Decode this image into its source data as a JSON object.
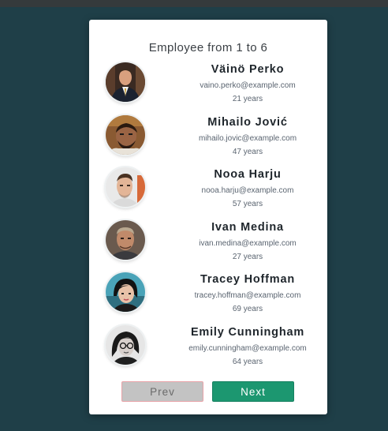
{
  "header": {
    "title": "Employee from 1 to 6"
  },
  "employees": [
    {
      "name": "Väinö Perko",
      "email": "vaino.perko@example.com",
      "age": "21 years"
    },
    {
      "name": "Mihailo Jović",
      "email": "mihailo.jovic@example.com",
      "age": "47 years"
    },
    {
      "name": "Nooa Harju",
      "email": "nooa.harju@example.com",
      "age": "57 years"
    },
    {
      "name": "Ivan Medina",
      "email": "ivan.medina@example.com",
      "age": "27 years"
    },
    {
      "name": "Tracey Hoffman",
      "email": "tracey.hoffman@example.com",
      "age": "69 years"
    },
    {
      "name": "Emily Cunningham",
      "email": "emily.cunningham@example.com",
      "age": "64 years"
    }
  ],
  "pagination": {
    "prev_label": "Prev",
    "next_label": "Next"
  },
  "colors": {
    "background": "#1f3f48",
    "next_button": "#1c9770",
    "prev_button": "#c3c3c3"
  }
}
